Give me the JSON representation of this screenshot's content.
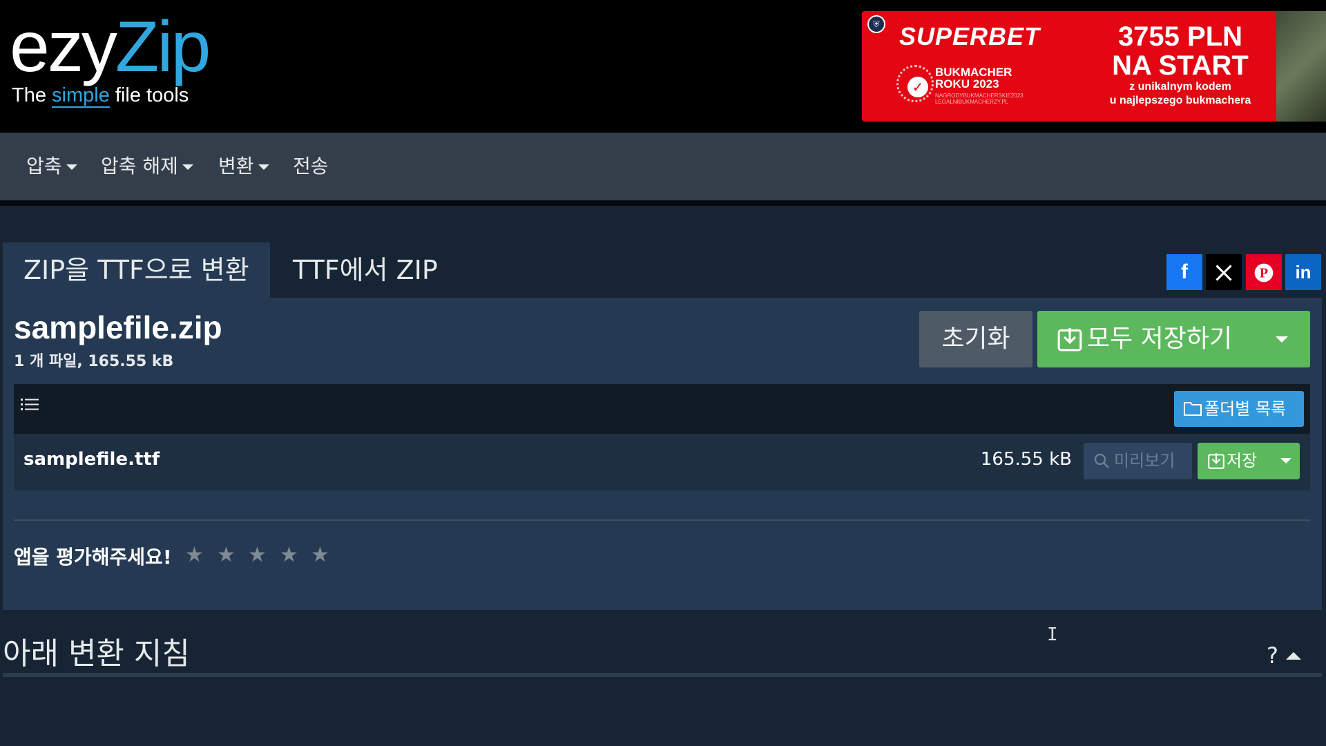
{
  "header": {
    "logo": {
      "part1": "ezy",
      "part2": "Zip",
      "tagline_pre": "The ",
      "tagline_accent": "simple",
      "tagline_post": " file tools"
    },
    "ad": {
      "brand": "SUPERBET",
      "award_line1": "BUKMACHER",
      "award_line2": "ROKU 2023",
      "fine_print_1": "NAGRODYBUKMACHERSKIE2023",
      "fine_print_2": "LEGALNIBUKMACHERZY.PL",
      "amount_line1": "3755 PLN",
      "amount_line2": "NA START",
      "sub_line1": "z unikalnym kodem",
      "sub_line2": "u najlepszego bukmachera",
      "accent_color": "#e30613"
    }
  },
  "nav": {
    "items": [
      {
        "label": "압축",
        "dropdown": true
      },
      {
        "label": "압축 해제",
        "dropdown": true
      },
      {
        "label": "변환",
        "dropdown": true
      },
      {
        "label": "전송",
        "dropdown": false
      }
    ]
  },
  "tabs": [
    {
      "label": "ZIP을 TTF으로 변환",
      "active": true
    },
    {
      "label": "TTF에서 ZIP",
      "active": false
    }
  ],
  "social": [
    {
      "icon": "facebook-icon",
      "glyph": "f",
      "color": "#1877f2"
    },
    {
      "icon": "x-icon",
      "glyph": "𝕏",
      "color": "#000000"
    },
    {
      "icon": "pinterest-icon",
      "glyph": "P",
      "color": "#e60023"
    },
    {
      "icon": "linkedin-icon",
      "glyph": "in",
      "color": "#0a66c2"
    }
  ],
  "archive": {
    "name": "samplefile.zip",
    "meta": "1 개 파일, 165.55 kB",
    "reset_label": "초기화",
    "save_all_label": "모두 저장하기",
    "folder_view_label": "폴더별 목록"
  },
  "files": [
    {
      "name": "samplefile.ttf",
      "size": "165.55 kB",
      "preview_label": "미리보기",
      "save_label": "저장"
    }
  ],
  "rating": {
    "label": "앱을 평가해주세요!",
    "stars": 5,
    "star_glyph": "★"
  },
  "guide": {
    "title": "아래 변환 지침",
    "help_glyph": "?"
  },
  "colors": {
    "background": "#172433",
    "panel": "#253a52",
    "primary_green": "#5cb85c",
    "primary_blue": "#3498db",
    "brand_blue": "#31a7df"
  }
}
